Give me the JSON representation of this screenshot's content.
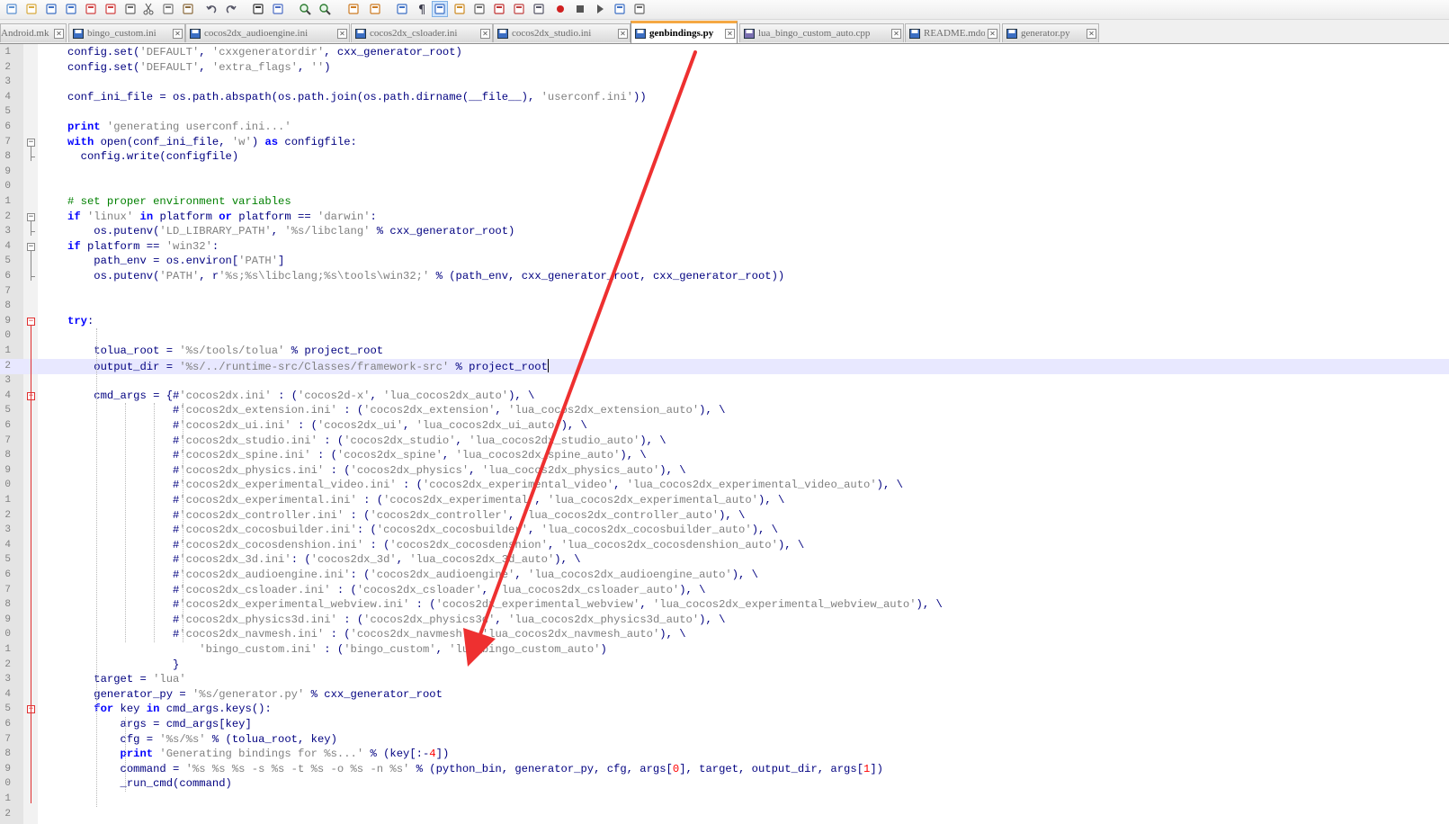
{
  "colors": {
    "arrow": "#ee3030",
    "keyword": "#0000ff",
    "string": "#808080",
    "comment": "#008000",
    "number": "#ff0000",
    "text": "#000080"
  },
  "toolbar": {
    "buttons": [
      "new-file-icon",
      "open-file-icon",
      "save-icon",
      "save-all-icon",
      "close-icon",
      "close-all-icon",
      "print-icon",
      "cut-icon",
      "copy-icon",
      "paste-icon",
      "undo-icon",
      "redo-icon",
      "find-icon",
      "replace-icon",
      "zoom-in-icon",
      "zoom-out-icon",
      "sync-vertical-icon",
      "sync-horizontal-icon",
      "word-wrap-icon",
      "show-all-chars-icon",
      "indent-guide-icon",
      "user-lang-icon",
      "doc-map-icon",
      "function-list-icon",
      "folder-workspace-icon",
      "monitor-icon",
      "record-macro-icon",
      "stop-record-icon",
      "play-macro-icon",
      "run-macro-multiple-icon",
      "save-macro-icon"
    ]
  },
  "tabs": [
    {
      "label": "Android.mk",
      "active": false
    },
    {
      "label": "bingo_custom.ini",
      "active": false
    },
    {
      "label": "cocos2dx_audioengine.ini",
      "active": false
    },
    {
      "label": "cocos2dx_csloader.ini",
      "active": false
    },
    {
      "label": "cocos2dx_studio.ini",
      "active": false
    },
    {
      "label": "genbindings.py",
      "active": true
    },
    {
      "label": "lua_bingo_custom_auto.cpp",
      "active": false
    },
    {
      "label": "README.mdown",
      "active": false
    },
    {
      "label": "generator.py",
      "active": false
    }
  ],
  "editor": {
    "line_numbers": [
      "1",
      "2",
      "3",
      "4",
      "5",
      "6",
      "7",
      "8",
      "9",
      "0",
      "1",
      "2",
      "3",
      "4",
      "5",
      "6",
      "7",
      "8",
      "9",
      "0",
      "1",
      "2",
      "3",
      "4",
      "5",
      "6",
      "7",
      "8",
      "9",
      "0",
      "1",
      "2",
      "3",
      "4",
      "5",
      "6",
      "7",
      "8",
      "9",
      "0",
      "1",
      "2",
      "3",
      "4",
      "5",
      "6",
      "7",
      "8",
      "9",
      "0",
      "1",
      "2"
    ],
    "lines": [
      [
        [
          "t",
          "config.set("
        ],
        [
          "s",
          "'DEFAULT'"
        ],
        [
          "t",
          ", "
        ],
        [
          "s",
          "'cxxgeneratordir'"
        ],
        [
          "t",
          ", cxx_generator_root)"
        ]
      ],
      [
        [
          "t",
          "config.set("
        ],
        [
          "s",
          "'DEFAULT'"
        ],
        [
          "t",
          ", "
        ],
        [
          "s",
          "'extra_flags'"
        ],
        [
          "t",
          ", "
        ],
        [
          "s",
          "''"
        ],
        [
          "t",
          ")"
        ]
      ],
      [],
      [
        [
          "t",
          "conf_ini_file = os.path.abspath(os.path.join(os.path.dirname(__file__), "
        ],
        [
          "s",
          "'userconf.ini'"
        ],
        [
          "t",
          "))"
        ]
      ],
      [],
      [
        [
          "k",
          "print"
        ],
        [
          "t",
          " "
        ],
        [
          "s",
          "'generating userconf.ini...'"
        ]
      ],
      [
        [
          "k",
          "with"
        ],
        [
          "t",
          " open(conf_ini_file, "
        ],
        [
          "s",
          "'w'"
        ],
        [
          "t",
          ") "
        ],
        [
          "k",
          "as"
        ],
        [
          "t",
          " configfile:"
        ]
      ],
      [
        [
          "t",
          "  config.write(configfile)"
        ]
      ],
      [],
      [],
      [
        [
          "c",
          "# set proper environment variables"
        ]
      ],
      [
        [
          "k",
          "if"
        ],
        [
          "t",
          " "
        ],
        [
          "s",
          "'linux'"
        ],
        [
          "t",
          " "
        ],
        [
          "k",
          "in"
        ],
        [
          "t",
          " platform "
        ],
        [
          "k",
          "or"
        ],
        [
          "t",
          " platform == "
        ],
        [
          "s",
          "'darwin'"
        ],
        [
          "t",
          ":"
        ]
      ],
      [
        [
          "t",
          "    os.putenv("
        ],
        [
          "s",
          "'LD_LIBRARY_PATH'"
        ],
        [
          "t",
          ", "
        ],
        [
          "s",
          "'%s/libclang'"
        ],
        [
          "t",
          " % cxx_generator_root)"
        ]
      ],
      [
        [
          "k",
          "if"
        ],
        [
          "t",
          " platform == "
        ],
        [
          "s",
          "'win32'"
        ],
        [
          "t",
          ":"
        ]
      ],
      [
        [
          "t",
          "    path_env = os.environ["
        ],
        [
          "s",
          "'PATH'"
        ],
        [
          "t",
          "]"
        ]
      ],
      [
        [
          "t",
          "    os.putenv("
        ],
        [
          "s",
          "'PATH'"
        ],
        [
          "t",
          ", r"
        ],
        [
          "s",
          "'%s;%s\\libclang;%s\\tools\\win32;'"
        ],
        [
          "t",
          " % (path_env, cxx_generator_root, cxx_generator_root))"
        ]
      ],
      [],
      [],
      [
        [
          "k",
          "try"
        ],
        [
          "t",
          ":"
        ]
      ],
      [],
      [
        [
          "t",
          "    tolua_root = "
        ],
        [
          "s",
          "'%s/tools/tolua'"
        ],
        [
          "t",
          " % project_root"
        ]
      ],
      [
        [
          "t",
          "    output_dir = "
        ],
        [
          "s",
          "'%s/../runtime-src/Classes/framework-src'"
        ],
        [
          "t",
          " % project_root"
        ]
      ],
      [],
      [
        [
          "t",
          "    cmd_args = {#"
        ],
        [
          "s",
          "'cocos2dx.ini'"
        ],
        [
          "t",
          " : ("
        ],
        [
          "s",
          "'cocos2d-x'"
        ],
        [
          "t",
          ", "
        ],
        [
          "s",
          "'lua_cocos2dx_auto'"
        ],
        [
          "t",
          "), \\"
        ]
      ],
      [
        [
          "t",
          "                #"
        ],
        [
          "s",
          "'cocos2dx_extension.ini'"
        ],
        [
          "t",
          " : ("
        ],
        [
          "s",
          "'cocos2dx_extension'"
        ],
        [
          "t",
          ", "
        ],
        [
          "s",
          "'lua_cocos2dx_extension_auto'"
        ],
        [
          "t",
          "), \\"
        ]
      ],
      [
        [
          "t",
          "                #"
        ],
        [
          "s",
          "'cocos2dx_ui.ini'"
        ],
        [
          "t",
          " : ("
        ],
        [
          "s",
          "'cocos2dx_ui'"
        ],
        [
          "t",
          ", "
        ],
        [
          "s",
          "'lua_cocos2dx_ui_auto'"
        ],
        [
          "t",
          "), \\"
        ]
      ],
      [
        [
          "t",
          "                #"
        ],
        [
          "s",
          "'cocos2dx_studio.ini'"
        ],
        [
          "t",
          " : ("
        ],
        [
          "s",
          "'cocos2dx_studio'"
        ],
        [
          "t",
          ", "
        ],
        [
          "s",
          "'lua_cocos2dx_studio_auto'"
        ],
        [
          "t",
          "), \\"
        ]
      ],
      [
        [
          "t",
          "                #"
        ],
        [
          "s",
          "'cocos2dx_spine.ini'"
        ],
        [
          "t",
          " : ("
        ],
        [
          "s",
          "'cocos2dx_spine'"
        ],
        [
          "t",
          ", "
        ],
        [
          "s",
          "'lua_cocos2dx_spine_auto'"
        ],
        [
          "t",
          "), \\"
        ]
      ],
      [
        [
          "t",
          "                #"
        ],
        [
          "s",
          "'cocos2dx_physics.ini'"
        ],
        [
          "t",
          " : ("
        ],
        [
          "s",
          "'cocos2dx_physics'"
        ],
        [
          "t",
          ", "
        ],
        [
          "s",
          "'lua_cocos2dx_physics_auto'"
        ],
        [
          "t",
          "), \\"
        ]
      ],
      [
        [
          "t",
          "                #"
        ],
        [
          "s",
          "'cocos2dx_experimental_video.ini'"
        ],
        [
          "t",
          " : ("
        ],
        [
          "s",
          "'cocos2dx_experimental_video'"
        ],
        [
          "t",
          ", "
        ],
        [
          "s",
          "'lua_cocos2dx_experimental_video_auto'"
        ],
        [
          "t",
          "), \\"
        ]
      ],
      [
        [
          "t",
          "                #"
        ],
        [
          "s",
          "'cocos2dx_experimental.ini'"
        ],
        [
          "t",
          " : ("
        ],
        [
          "s",
          "'cocos2dx_experimental'"
        ],
        [
          "t",
          ", "
        ],
        [
          "s",
          "'lua_cocos2dx_experimental_auto'"
        ],
        [
          "t",
          "), \\"
        ]
      ],
      [
        [
          "t",
          "                #"
        ],
        [
          "s",
          "'cocos2dx_controller.ini'"
        ],
        [
          "t",
          " : ("
        ],
        [
          "s",
          "'cocos2dx_controller'"
        ],
        [
          "t",
          ", "
        ],
        [
          "s",
          "'lua_cocos2dx_controller_auto'"
        ],
        [
          "t",
          "), \\"
        ]
      ],
      [
        [
          "t",
          "                #"
        ],
        [
          "s",
          "'cocos2dx_cocosbuilder.ini'"
        ],
        [
          "t",
          ": ("
        ],
        [
          "s",
          "'cocos2dx_cocosbuilder'"
        ],
        [
          "t",
          ", "
        ],
        [
          "s",
          "'lua_cocos2dx_cocosbuilder_auto'"
        ],
        [
          "t",
          "), \\"
        ]
      ],
      [
        [
          "t",
          "                #"
        ],
        [
          "s",
          "'cocos2dx_cocosdenshion.ini'"
        ],
        [
          "t",
          " : ("
        ],
        [
          "s",
          "'cocos2dx_cocosdenshion'"
        ],
        [
          "t",
          ", "
        ],
        [
          "s",
          "'lua_cocos2dx_cocosdenshion_auto'"
        ],
        [
          "t",
          "), \\"
        ]
      ],
      [
        [
          "t",
          "                #"
        ],
        [
          "s",
          "'cocos2dx_3d.ini'"
        ],
        [
          "t",
          ": ("
        ],
        [
          "s",
          "'cocos2dx_3d'"
        ],
        [
          "t",
          ", "
        ],
        [
          "s",
          "'lua_cocos2dx_3d_auto'"
        ],
        [
          "t",
          "), \\"
        ]
      ],
      [
        [
          "t",
          "                #"
        ],
        [
          "s",
          "'cocos2dx_audioengine.ini'"
        ],
        [
          "t",
          ": ("
        ],
        [
          "s",
          "'cocos2dx_audioengine'"
        ],
        [
          "t",
          ", "
        ],
        [
          "s",
          "'lua_cocos2dx_audioengine_auto'"
        ],
        [
          "t",
          "), \\"
        ]
      ],
      [
        [
          "t",
          "                #"
        ],
        [
          "s",
          "'cocos2dx_csloader.ini'"
        ],
        [
          "t",
          " : ("
        ],
        [
          "s",
          "'cocos2dx_csloader'"
        ],
        [
          "t",
          ", "
        ],
        [
          "s",
          "'lua_cocos2dx_csloader_auto'"
        ],
        [
          "t",
          "), \\"
        ]
      ],
      [
        [
          "t",
          "                #"
        ],
        [
          "s",
          "'cocos2dx_experimental_webview.ini'"
        ],
        [
          "t",
          " : ("
        ],
        [
          "s",
          "'cocos2dx_experimental_webview'"
        ],
        [
          "t",
          ", "
        ],
        [
          "s",
          "'lua_cocos2dx_experimental_webview_auto'"
        ],
        [
          "t",
          "), \\"
        ]
      ],
      [
        [
          "t",
          "                #"
        ],
        [
          "s",
          "'cocos2dx_physics3d.ini'"
        ],
        [
          "t",
          " : ("
        ],
        [
          "s",
          "'cocos2dx_physics3d'"
        ],
        [
          "t",
          ", "
        ],
        [
          "s",
          "'lua_cocos2dx_physics3d_auto'"
        ],
        [
          "t",
          "), \\"
        ]
      ],
      [
        [
          "t",
          "                #"
        ],
        [
          "s",
          "'cocos2dx_navmesh.ini'"
        ],
        [
          "t",
          " : ("
        ],
        [
          "s",
          "'cocos2dx_navmesh'"
        ],
        [
          "t",
          ", "
        ],
        [
          "s",
          "'lua_cocos2dx_navmesh_auto'"
        ],
        [
          "t",
          "), \\"
        ]
      ],
      [
        [
          "t",
          "                    "
        ],
        [
          "s",
          "'bingo_custom.ini'"
        ],
        [
          "t",
          " : ("
        ],
        [
          "s",
          "'bingo_custom'"
        ],
        [
          "t",
          ", "
        ],
        [
          "s",
          "'lua_bingo_custom_auto'"
        ],
        [
          "t",
          ")"
        ]
      ],
      [
        [
          "t",
          "                }"
        ]
      ],
      [
        [
          "t",
          "    target = "
        ],
        [
          "s",
          "'lua'"
        ]
      ],
      [
        [
          "t",
          "    generator_py = "
        ],
        [
          "s",
          "'%s/generator.py'"
        ],
        [
          "t",
          " % cxx_generator_root"
        ]
      ],
      [
        [
          "t",
          "    "
        ],
        [
          "k",
          "for"
        ],
        [
          "t",
          " key "
        ],
        [
          "k",
          "in"
        ],
        [
          "t",
          " cmd_args.keys():"
        ]
      ],
      [
        [
          "t",
          "        args = cmd_args[key]"
        ]
      ],
      [
        [
          "t",
          "        cfg = "
        ],
        [
          "s",
          "'%s/%s'"
        ],
        [
          "t",
          " % (tolua_root, key)"
        ]
      ],
      [
        [
          "t",
          "        "
        ],
        [
          "k",
          "print"
        ],
        [
          "t",
          " "
        ],
        [
          "s",
          "'Generating bindings for %s...'"
        ],
        [
          "t",
          " % (key[:-"
        ],
        [
          "n",
          "4"
        ],
        [
          "t",
          "])"
        ]
      ],
      [
        [
          "t",
          "        command = "
        ],
        [
          "s",
          "'%s %s %s -s %s -t %s -o %s -n %s'"
        ],
        [
          "t",
          " % (python_bin, generator_py, cfg, args["
        ],
        [
          "n",
          "0"
        ],
        [
          "t",
          "], target, output_dir, args["
        ],
        [
          "n",
          "1"
        ],
        [
          "t",
          "])"
        ]
      ],
      [
        [
          "t",
          "        _run_cmd(command)"
        ]
      ],
      [],
      []
    ]
  }
}
